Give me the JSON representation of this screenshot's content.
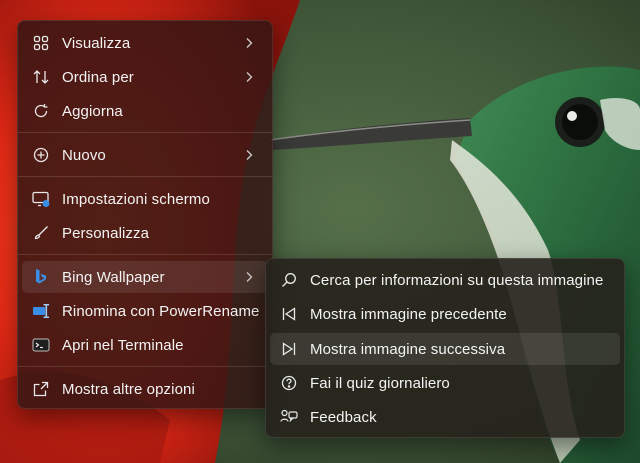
{
  "context_menu": {
    "items": [
      {
        "label": "Visualizza",
        "icon": "grid-icon",
        "has_submenu": true
      },
      {
        "label": "Ordina per",
        "icon": "sort-icon",
        "has_submenu": true
      },
      {
        "label": "Aggiorna",
        "icon": "refresh-icon",
        "has_submenu": false
      },
      {
        "label": "Nuovo",
        "icon": "plus-circle-icon",
        "has_submenu": true
      },
      {
        "label": "Impostazioni schermo",
        "icon": "display-settings-icon",
        "has_submenu": false
      },
      {
        "label": "Personalizza",
        "icon": "brush-icon",
        "has_submenu": false
      },
      {
        "label": "Bing Wallpaper",
        "icon": "bing-icon",
        "has_submenu": true
      },
      {
        "label": "Rinomina con PowerRename",
        "icon": "powerrename-icon",
        "has_submenu": false
      },
      {
        "label": "Apri nel Terminale",
        "icon": "terminal-icon",
        "has_submenu": false
      },
      {
        "label": "Mostra altre opzioni",
        "icon": "more-options-icon",
        "has_submenu": false
      }
    ],
    "active_item": "Bing Wallpaper"
  },
  "bing_submenu": {
    "items": [
      {
        "label": "Cerca per informazioni su questa immagine",
        "icon": "search-icon"
      },
      {
        "label": "Mostra immagine precedente",
        "icon": "previous-icon"
      },
      {
        "label": "Mostra immagine successiva",
        "icon": "next-icon"
      },
      {
        "label": "Fai il quiz giornaliero",
        "icon": "question-icon"
      },
      {
        "label": "Feedback",
        "icon": "feedback-icon"
      }
    ],
    "hovered_item": "Mostra immagine successiva"
  },
  "colors": {
    "accent_bing": "#3a8ee6",
    "menu_text": "#f3f3f3",
    "wallpaper_red": "#e8301a",
    "wallpaper_green": "#3f5a37"
  }
}
